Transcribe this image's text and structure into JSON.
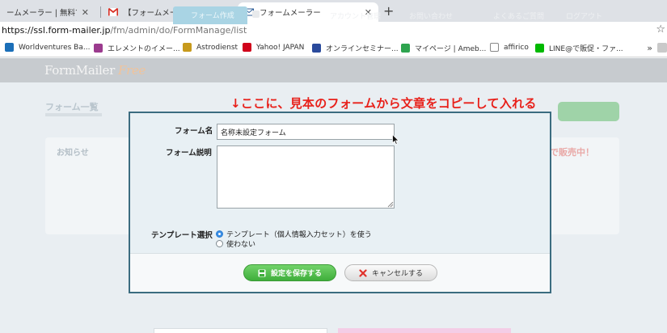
{
  "browser": {
    "tabs": [
      {
        "title": "ームメーラー | 無料でSSL・ス",
        "active": false,
        "icon": "page-icon"
      },
      {
        "title": "【フォームメーラー】Free 登録申",
        "active": false,
        "icon": "gmail-icon"
      },
      {
        "title": "フォームメーラー",
        "active": true,
        "icon": "mail-icon"
      }
    ],
    "new_tab_glyph": "+",
    "url_host": "https://ssl.form-mailer.jp",
    "url_path": "/fm/admin/do/FormManage/list",
    "bookmarks": [
      {
        "label": "Worldventures Ba...",
        "icon": "worldventures-icon",
        "color": "#1b6fb8"
      },
      {
        "label": "エレメントのイメー...",
        "icon": "moon-icon",
        "color": "#9b3b8e"
      },
      {
        "label": "Astrodienst",
        "icon": "astrodienst-icon",
        "color": "#c79a1c"
      },
      {
        "label": "Yahoo! JAPAN",
        "icon": "yahoo-icon",
        "color": "#d0021b"
      },
      {
        "label": "オンラインセミナー...",
        "icon": "seminar-icon",
        "color": "#2a4a9c"
      },
      {
        "label": "マイページ | Ameb...",
        "icon": "ameba-icon",
        "color": "#2ea44f"
      },
      {
        "label": "affirico",
        "icon": "page-icon",
        "color": "#ffffff"
      },
      {
        "label": "LINE@で販促・ファ...",
        "icon": "line-icon",
        "color": "#00b900"
      }
    ],
    "bookmarks_more": "»"
  },
  "site": {
    "logo": "FormMailer",
    "logo_free": "Free",
    "nav_active": "フォーム作成",
    "nav_links": [
      "アカウント管理",
      "お問い合わせ",
      "よくあるご質問",
      "ログアウト"
    ],
    "heading": "フォーム一覧",
    "notice": "お知らせ",
    "sale": "で販売中！"
  },
  "annotation": "↓ここに、見本のフォームから文章をコピーして入れる",
  "dialog": {
    "name_label": "フォーム名",
    "name_value": "名称未設定フォーム",
    "desc_label": "フォーム説明",
    "desc_value": "",
    "template_label": "テンプレート選択",
    "template_options": [
      {
        "label": "テンプレート（個人情報入力セット）を使う",
        "checked": true
      },
      {
        "label": "使わない",
        "checked": false
      }
    ],
    "save_label": "設定を保存する",
    "cancel_label": "キャンセルする"
  }
}
